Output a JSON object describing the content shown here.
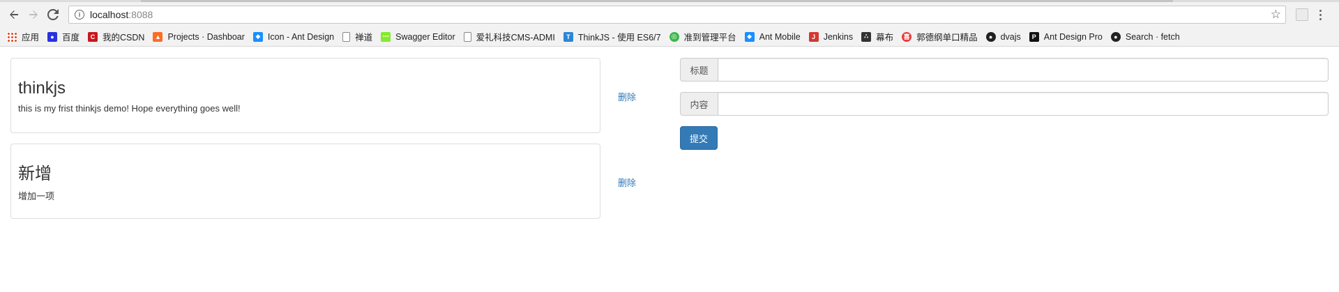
{
  "browser": {
    "url_host": "localhost",
    "url_port": ":8088",
    "bookmarks": [
      {
        "label": "应用",
        "icon": "apps-grid-icon",
        "color": "#e44d26"
      },
      {
        "label": "百度",
        "icon": "baidu-paw-icon",
        "color": "#2932e1"
      },
      {
        "label": "我的CSDN",
        "icon": "csdn-c-icon",
        "color": "#c9171e"
      },
      {
        "label": "Projects · Dashboar",
        "icon": "gitlab-fox-icon",
        "color": "#fc6d26"
      },
      {
        "label": "Icon - Ant Design",
        "icon": "ant-design-diamond-icon",
        "color": "#1890ff"
      },
      {
        "label": "禅道",
        "icon": "page-icon",
        "color": "#888888"
      },
      {
        "label": "Swagger Editor",
        "icon": "swagger-icon",
        "color": "#85ea2d"
      },
      {
        "label": "爱礼科技CMS-ADMI",
        "icon": "page-icon",
        "color": "#888888"
      },
      {
        "label": "ThinkJS - 使用 ES6/7",
        "icon": "thinkjs-shield-icon",
        "color": "#2c86d8"
      },
      {
        "label": "准到管理平台",
        "icon": "zhundao-icon",
        "color": "#3bb84a"
      },
      {
        "label": "Ant Mobile",
        "icon": "ant-mobile-icon",
        "color": "#1890ff"
      },
      {
        "label": "Jenkins",
        "icon": "jenkins-icon",
        "color": "#d33833"
      },
      {
        "label": "幕布",
        "icon": "mubu-nodes-icon",
        "color": "#333333"
      },
      {
        "label": "郭德纲单口精品",
        "icon": "ximalaya-icon",
        "color": "#e83b3b"
      },
      {
        "label": "dvajs",
        "icon": "github-icon",
        "color": "#222222"
      },
      {
        "label": "Ant Design Pro",
        "icon": "ant-design-pro-icon",
        "color": "#111111"
      },
      {
        "label": "Search · fetch",
        "icon": "github-icon",
        "color": "#222222"
      }
    ]
  },
  "items": [
    {
      "title": "thinkjs",
      "content": "this is my frist thinkjs demo! Hope everything goes well!",
      "delete_label": "删除"
    },
    {
      "title": "新增",
      "content": "增加一项",
      "delete_label": "删除"
    }
  ],
  "form": {
    "title_label": "标题",
    "title_value": "",
    "content_label": "内容",
    "content_value": "",
    "submit_label": "提交"
  },
  "colors": {
    "link": "#337ab7",
    "primary_button": "#337ab7"
  }
}
